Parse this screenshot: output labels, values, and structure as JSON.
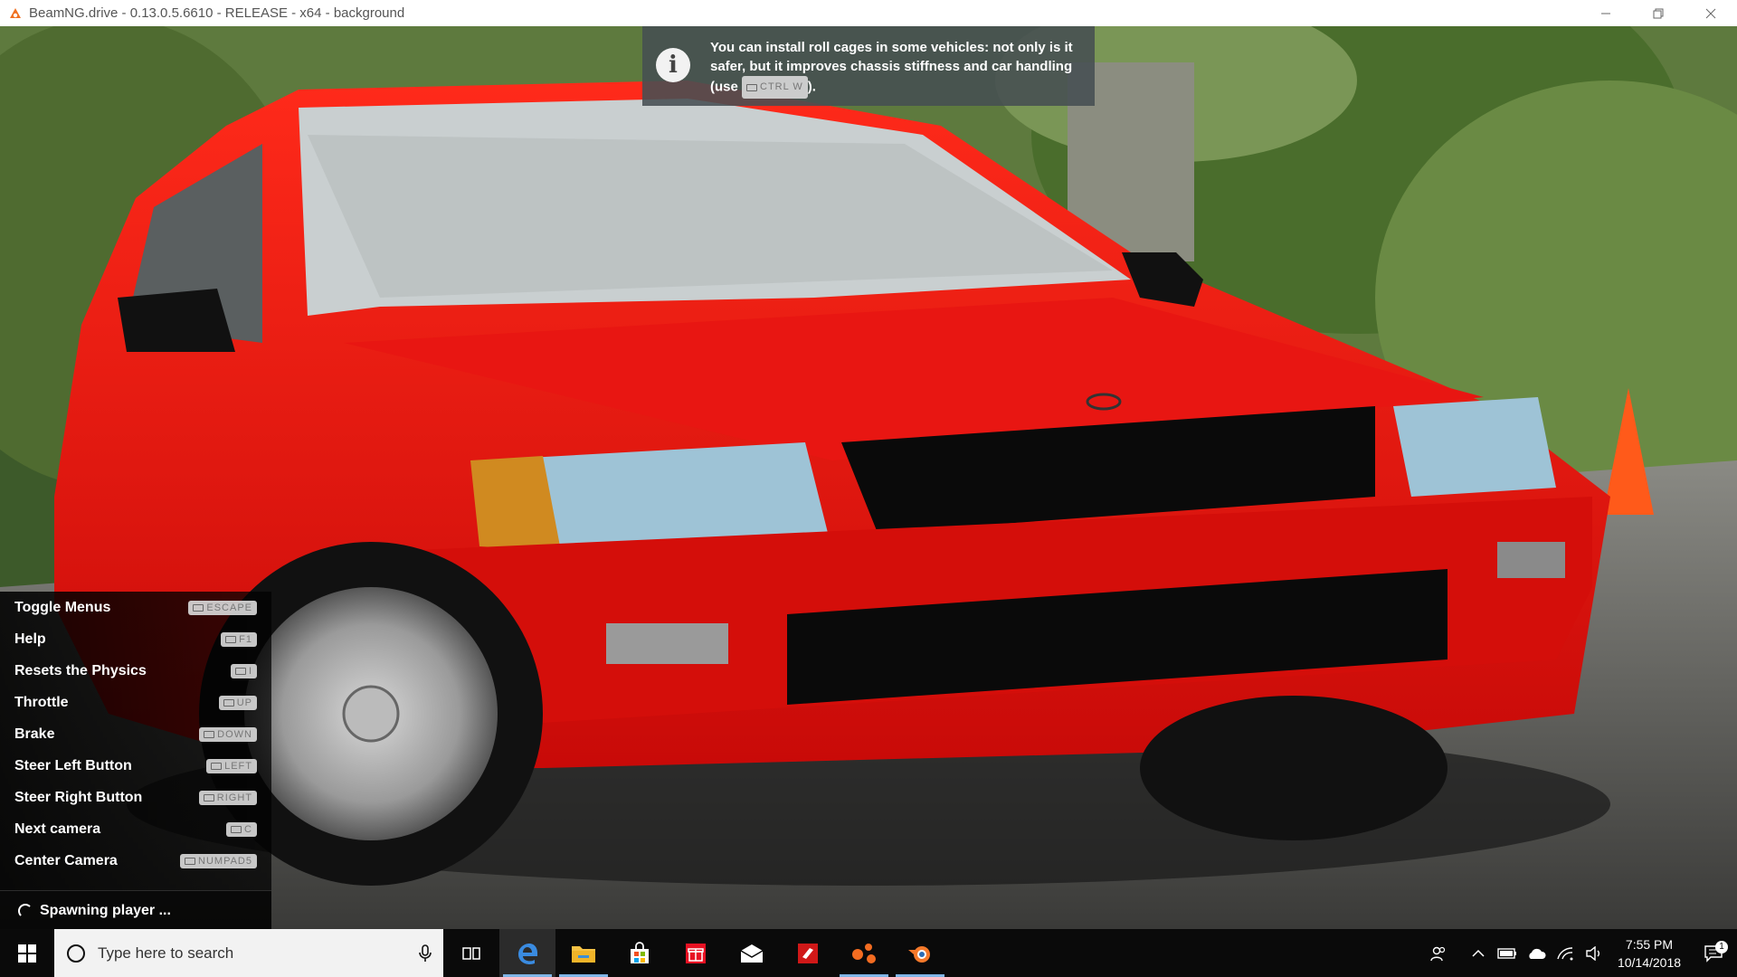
{
  "window": {
    "title": "BeamNG.drive - 0.13.0.5.6610 - RELEASE - x64 - background"
  },
  "tip": {
    "text_before": "You can install roll cages in some vehicles: not only is it safer, but it improves chassis stiffness and car handling (use ",
    "key": "CTRL W",
    "text_after": ")."
  },
  "shortcuts": [
    {
      "label": "Toggle Menus",
      "key": "ESCAPE"
    },
    {
      "label": "Help",
      "key": "F1"
    },
    {
      "label": "Resets the Physics",
      "key": "I"
    },
    {
      "label": "Throttle",
      "key": "UP"
    },
    {
      "label": "Brake",
      "key": "DOWN"
    },
    {
      "label": "Steer Left Button",
      "key": "LEFT"
    },
    {
      "label": "Steer Right Button",
      "key": "RIGHT"
    },
    {
      "label": "Next camera",
      "key": "C"
    },
    {
      "label": "Center Camera",
      "key": "NUMPAD5"
    }
  ],
  "status": {
    "text": "Spawning player ..."
  },
  "taskbar": {
    "search_placeholder": "Type here to search",
    "time": "7:55 PM",
    "date": "10/14/2018",
    "notification_count": "1"
  },
  "colors": {
    "car_red": "#e01010",
    "tip_bg": "#464e52",
    "taskbar_bg": "#0a0a0a"
  }
}
